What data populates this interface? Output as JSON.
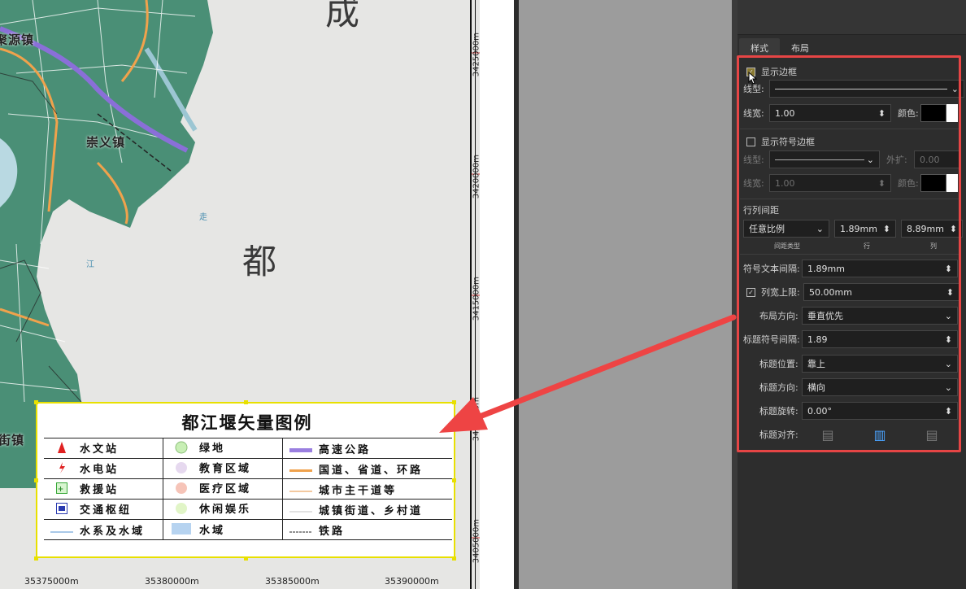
{
  "map": {
    "big_char_top": "成",
    "big_char_mid": "都",
    "towns": [
      "聚源镇",
      "崇义镇",
      "柳街镇"
    ],
    "river_label_1": "走",
    "river_label_2": "江",
    "y_coords": [
      "3425000m",
      "3420000m",
      "3415000m",
      "3410000m",
      "3405000m"
    ],
    "x_coords": [
      "35375000m",
      "35380000m",
      "35385000m",
      "35390000m"
    ]
  },
  "legend": {
    "title": "都江堰矢量图例",
    "rows": [
      [
        "水文站",
        "绿地",
        "高速公路"
      ],
      [
        "水电站",
        "教育区域",
        "国道、省道、环路"
      ],
      [
        "救援站",
        "医疗区域",
        "城市主干道等"
      ],
      [
        "交通枢纽",
        "休闲娱乐",
        "城镇街道、乡村道"
      ],
      [
        "水系及水域",
        "水域",
        "铁路"
      ]
    ]
  },
  "panel": {
    "tabs": [
      "样式",
      "布局"
    ],
    "show_border": "显示边框",
    "line_type": "线型:",
    "line_width": "线宽:",
    "line_width_val": "1.00",
    "color": "颜色:",
    "show_symbol_border": "显示符号边框",
    "sym_line_type": "线型:",
    "expand": "外扩:",
    "expand_val": "0.00",
    "sym_line_width": "线宽:",
    "sym_line_width_val": "1.00",
    "sym_color": "颜色:",
    "spacing_header": "行列间距",
    "spacing_type": "任意比例",
    "row_val": "1.89mm",
    "col_val": "8.89mm",
    "sub_type": "间距类型",
    "sub_row": "行",
    "sub_col": "列",
    "symbol_text_gap": "符号文本间隔:",
    "symbol_text_gap_val": "1.89mm",
    "col_width_limit": "列宽上限:",
    "col_width_limit_val": "50.00mm",
    "layout_dir": "布局方向:",
    "layout_dir_val": "垂直优先",
    "title_sym_gap": "标题符号间隔:",
    "title_sym_gap_val": "1.89",
    "title_pos": "标题位置:",
    "title_pos_val": "靠上",
    "title_dir": "标题方向:",
    "title_dir_val": "横向",
    "title_rot": "标题旋转:",
    "title_rot_val": "0.00°",
    "title_align": "标题对齐:"
  }
}
